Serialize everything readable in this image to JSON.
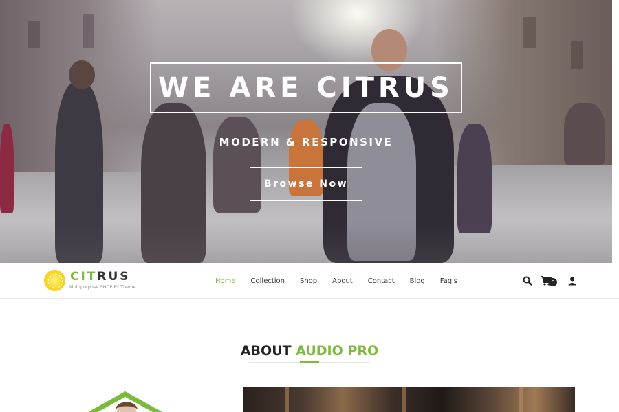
{
  "hero": {
    "title": "WE ARE CITRUS",
    "subtitle": "MODERN & RESPONSIVE",
    "button_label": "Browse Now"
  },
  "navbar": {
    "logo": {
      "name_green": "CIT",
      "name_dark": "RUS",
      "tagline": "Multipurpose SHOPIFY Theme"
    },
    "menu": [
      {
        "label": "Home",
        "active": true
      },
      {
        "label": "Collection",
        "active": false
      },
      {
        "label": "Shop",
        "active": false
      },
      {
        "label": "About",
        "active": false
      },
      {
        "label": "Contact",
        "active": false
      },
      {
        "label": "Blog",
        "active": false
      },
      {
        "label": "Faq's",
        "active": false
      }
    ],
    "icons": [
      "search-icon",
      "cart-icon",
      "user-icon"
    ],
    "cart_count": "0"
  },
  "about": {
    "title_dark": "ABOUT",
    "title_green": "AUDIO PRO"
  },
  "colors": {
    "accent": "#7cba3c",
    "text_dark": "#222222",
    "hero_text": "#ffffff"
  }
}
